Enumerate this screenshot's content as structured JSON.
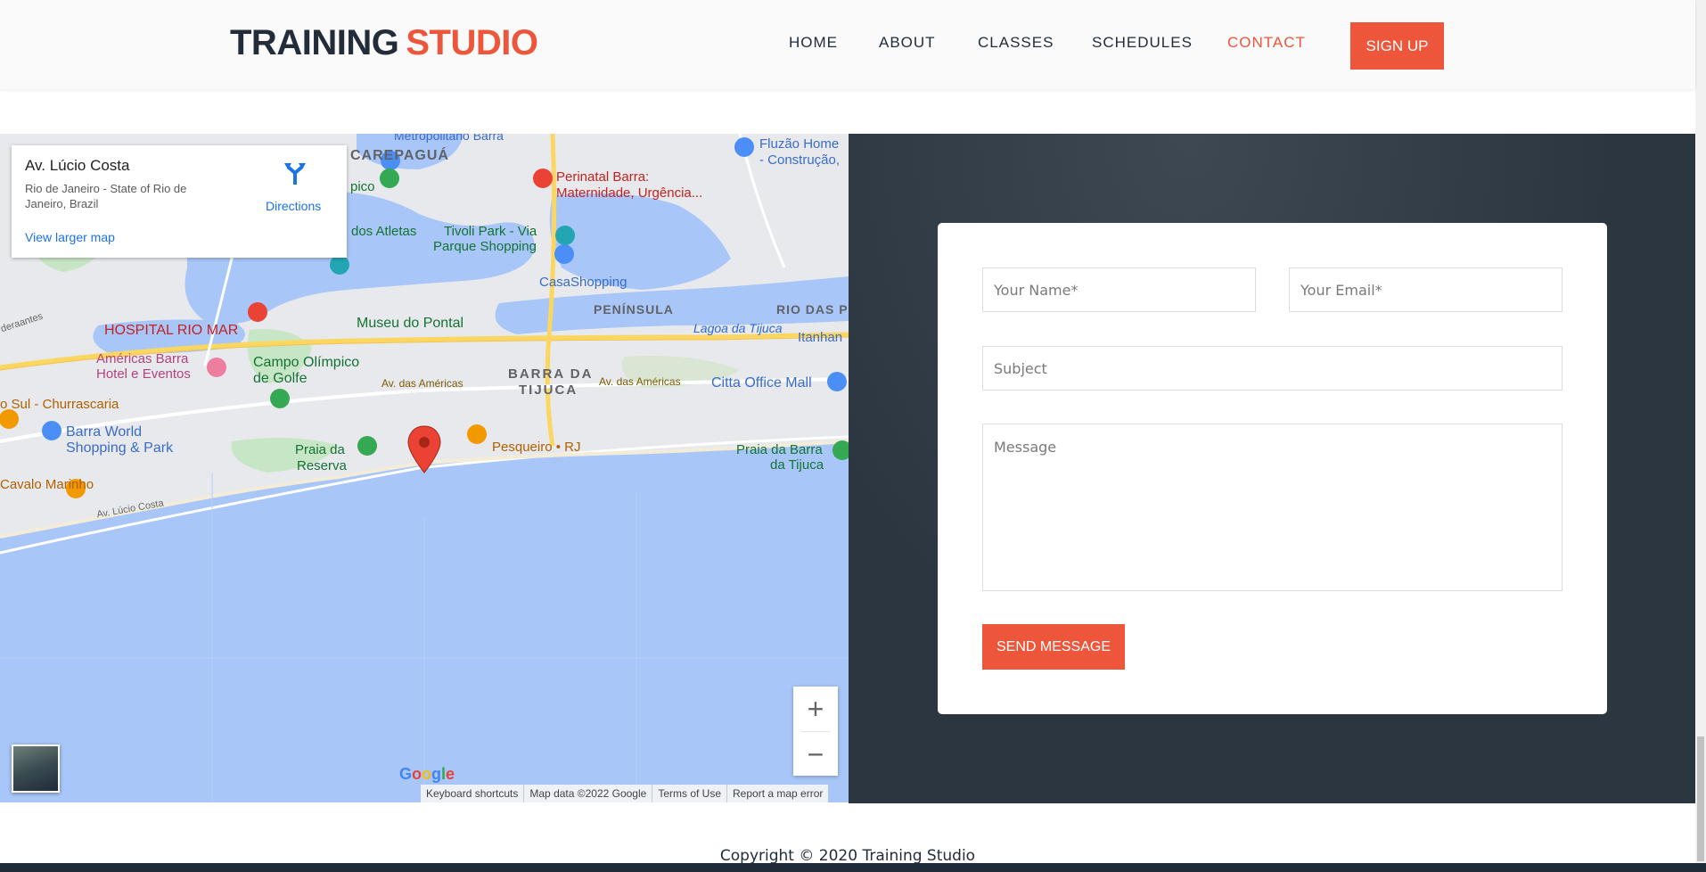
{
  "header": {
    "logo_part1": "TRAINING",
    "logo_part2": "STUDIO",
    "nav": [
      "HOME",
      "ABOUT",
      "CLASSES",
      "SCHEDULES",
      "CONTACT"
    ],
    "active_nav": "CONTACT",
    "signup_label": "SIGN UP"
  },
  "map": {
    "place_title": "Av. Lúcio Costa",
    "place_address": "Rio de Janeiro - State of Rio de Janeiro, Brazil",
    "directions_label": "Directions",
    "view_larger_label": "View larger map",
    "zoom_in": "+",
    "zoom_out": "−",
    "google_logo": "Google",
    "footer_links": [
      "Keyboard shortcuts",
      "Map data ©2022 Google",
      "Terms of Use",
      "Report a map error"
    ],
    "labels": {
      "metropolitano": "Metropolitano Barra",
      "carepagua": "CAREPAGUÁ",
      "fluzao": "Fluzão Home",
      "construcao": "- Construção,",
      "perinatal1": "Perinatal Barra:",
      "perinatal2": "Maternidade, Urgência...",
      "pico": "pico",
      "atletas": "dos Atletas",
      "tivoli1": "Tivoli Park - Via",
      "tivoli2": "Parque Shopping",
      "casashopping": "CasaShopping",
      "peninsula": "PENÍNSULA",
      "riodas": "RIO DAS P",
      "lagoa": "Lagoa da Tijuca",
      "itanhan": "Itanhan",
      "hospital": "HOSPITAL RIO MAR",
      "museu": "Museu do Pontal",
      "americas1": "Américas Barra",
      "americas2": "Hotel e Eventos",
      "campo1": "Campo Olímpico",
      "campo2": "de Golfe",
      "avamericas": "Av. das Américas",
      "barra1": "BARRA DA",
      "barra2": "TIJUCA",
      "avamericas2": "Av. das Américas",
      "citta": "Citta Office Mall",
      "churrascaria": "o Sul - Churrascaria",
      "barraworld1": "Barra World",
      "barraworld2": "Shopping & Park",
      "praiareserva1": "Praia da",
      "praiareserva2": "Reserva",
      "pesqueiro": "Pesqueiro • RJ",
      "praiabarra1": "Praia da Barra",
      "praiabarra2": "da Tijuca",
      "cavalo": "Cavalo Marinho",
      "avlucio": "Av. Lúcio Costa",
      "deraantes": "deraantes"
    }
  },
  "form": {
    "name_placeholder": "Your Name*",
    "email_placeholder": "Your Email*",
    "subject_placeholder": "Subject",
    "message_placeholder": "Message",
    "send_label": "SEND MESSAGE"
  },
  "footer": {
    "copyright": "Copyright © 2020 Training Studio"
  },
  "colors": {
    "accent": "#ed563b",
    "dark": "#232d39",
    "water": "#a9c6f8",
    "land": "#e9eaee",
    "green": "#c7e6c5",
    "link": "#1a73e8"
  }
}
